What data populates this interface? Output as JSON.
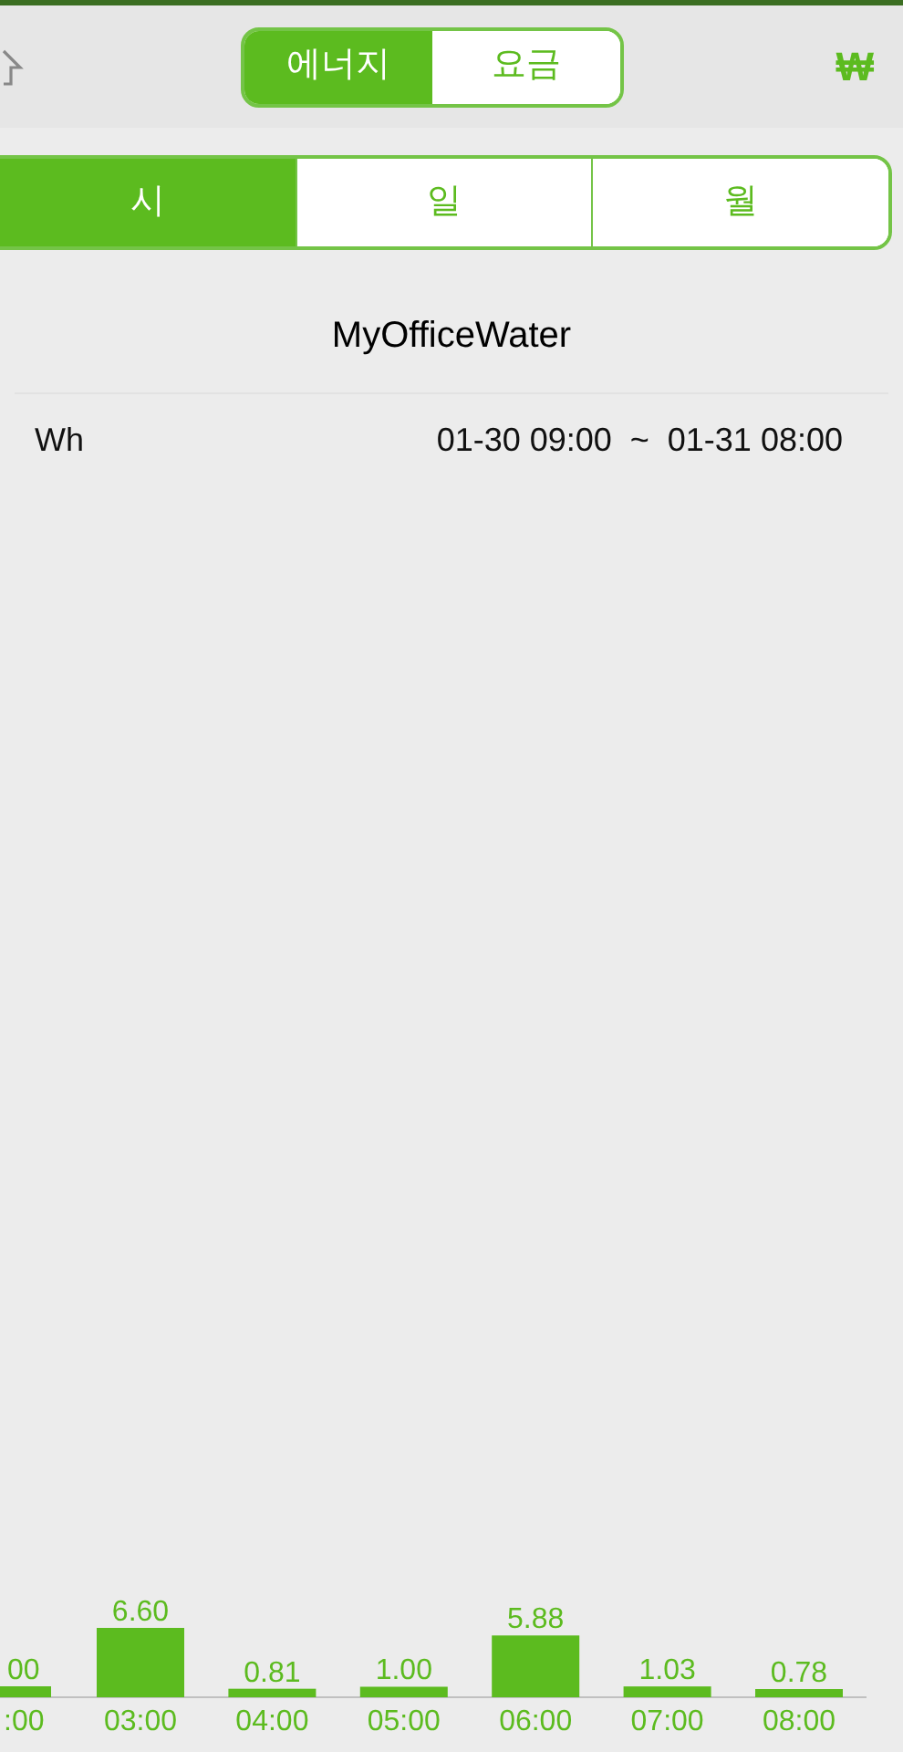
{
  "header": {
    "segments": [
      {
        "label": "에너지",
        "selected": true
      },
      {
        "label": "요금",
        "selected": false
      }
    ],
    "currency": "₩"
  },
  "period_tabs": [
    {
      "label": "시",
      "selected": true
    },
    {
      "label": "일",
      "selected": false
    },
    {
      "label": "월",
      "selected": false
    }
  ],
  "title": "MyOfficeWater",
  "unit": "Wh",
  "range": "01-30 09:00  ~  01-31 08:00",
  "chart_data": {
    "type": "bar",
    "categories": [
      ":00",
      "03:00",
      "04:00",
      "05:00",
      "06:00",
      "07:00",
      "08:00"
    ],
    "series": [
      {
        "color": "#5cbb1f",
        "values": [
          null,
          6.6,
          0.81,
          1.0,
          5.88,
          1.03,
          0.78
        ],
        "value_labels": [
          "00",
          "6.60",
          "0.81",
          "1.00",
          "5.88",
          "1.03",
          "0.78"
        ]
      }
    ],
    "data_labels": true
  }
}
